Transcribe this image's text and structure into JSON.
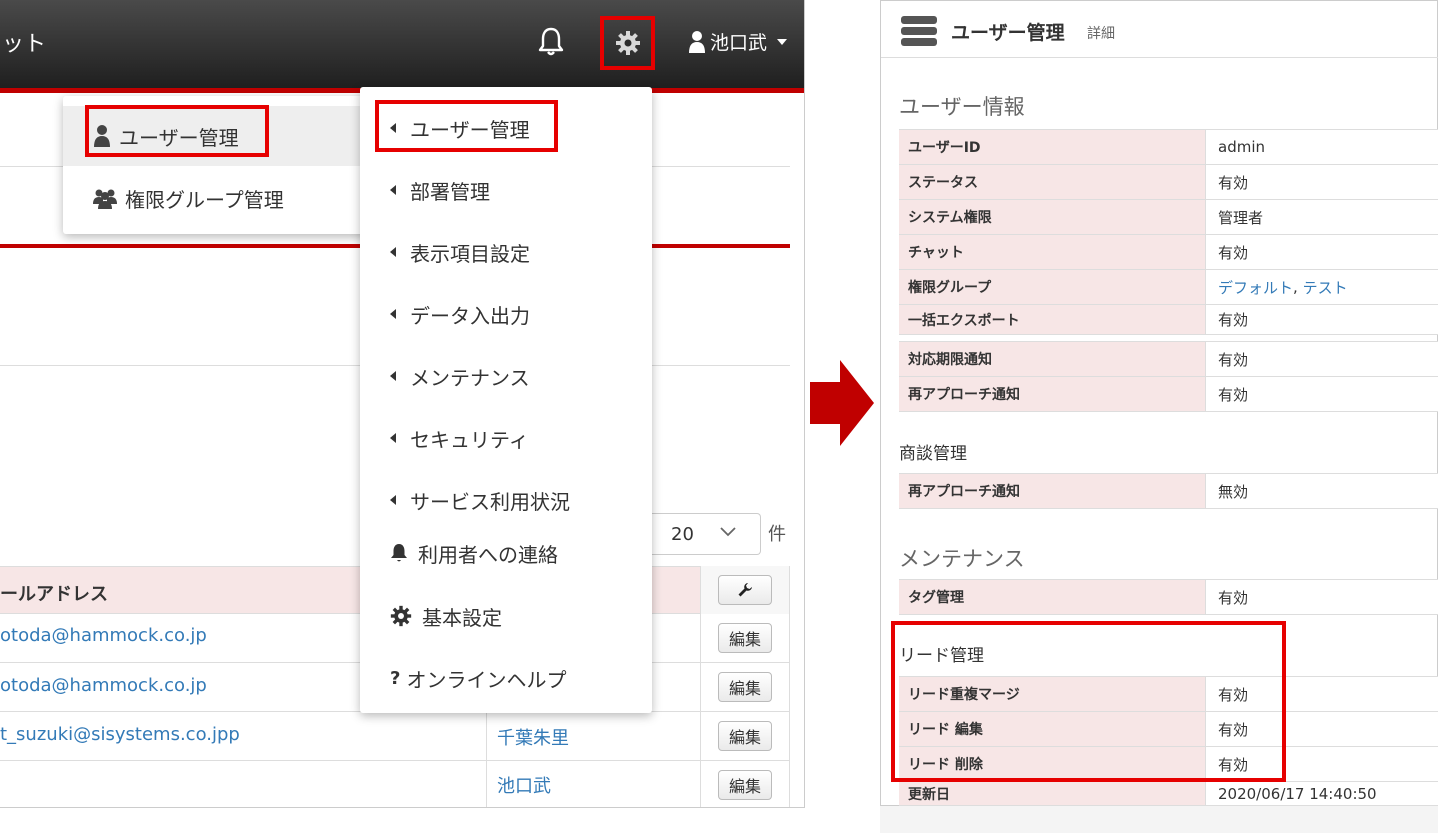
{
  "topbar": {
    "app_title_fragment": "ット",
    "user_name": "池口武"
  },
  "user_menu": {
    "items": [
      {
        "label": "ユーザー管理",
        "icon": "user-icon",
        "active": true
      },
      {
        "label": "権限グループ管理",
        "icon": "users-group-icon",
        "active": false
      }
    ]
  },
  "settings_menu": {
    "items": [
      {
        "label": "ユーザー管理",
        "icon": "caret-left-icon"
      },
      {
        "label": "部署管理",
        "icon": "caret-left-icon"
      },
      {
        "label": "表示項目設定",
        "icon": "caret-left-icon"
      },
      {
        "label": "データ入出力",
        "icon": "caret-left-icon"
      },
      {
        "label": "メンテナンス",
        "icon": "caret-left-icon"
      },
      {
        "label": "セキュリティ",
        "icon": "caret-left-icon"
      },
      {
        "label": "サービス利用状況",
        "icon": "caret-left-icon"
      },
      {
        "label": "利用者への連絡",
        "icon": "bell-icon"
      },
      {
        "label": "基本設定",
        "icon": "gear-icon"
      },
      {
        "label": "オンラインヘルプ",
        "icon": "question-icon"
      }
    ]
  },
  "list": {
    "page_size": "20",
    "page_size_unit": "件",
    "email_header": "ールアドレス",
    "edit_label": "編集",
    "rows": [
      {
        "email": "otoda@hammock.co.jp",
        "name": ""
      },
      {
        "email": "otoda@hammock.co.jp",
        "name": ""
      },
      {
        "email": "t_suzuki@sisystems.co.jpp",
        "name": "千葉朱里"
      },
      {
        "email": "",
        "name": "池口武"
      }
    ]
  },
  "detail": {
    "title": "ユーザー管理",
    "subtitle": "詳細",
    "user_info": {
      "heading": "ユーザー情報",
      "rows": [
        {
          "key": "ユーザーID",
          "value": "admin"
        },
        {
          "key": "ステータス",
          "value": "有効"
        },
        {
          "key": "システム権限",
          "value": "管理者"
        },
        {
          "key": "チャット",
          "value": "有効"
        },
        {
          "key": "権限グループ",
          "links": [
            "デフォルト",
            "テスト"
          ],
          "separator": ", "
        },
        {
          "key": "一括エクスポート",
          "value": "有効"
        }
      ]
    },
    "notify_rows": [
      {
        "key": "対応期限通知",
        "value": "有効"
      },
      {
        "key": "再アプローチ通知",
        "value": "有効"
      }
    ],
    "deal": {
      "heading": "商談管理",
      "rows": [
        {
          "key": "再アプローチ通知",
          "value": "無効"
        }
      ]
    },
    "maintenance": {
      "heading": "メンテナンス",
      "rows": [
        {
          "key": "タグ管理",
          "value": "有効"
        }
      ]
    },
    "lead": {
      "heading": "リード管理",
      "rows": [
        {
          "key": "リード重複マージ",
          "value": "有効"
        },
        {
          "key": "リード 編集",
          "value": "有効"
        },
        {
          "key": "リード 削除",
          "value": "有効"
        }
      ]
    },
    "updated": {
      "key": "更新日",
      "value": "2020/06/17 14:40:50"
    }
  },
  "colors": {
    "accent_red": "#e60000",
    "header_red": "#c00000",
    "link_blue": "#337ab7",
    "key_bg": "#f7e6e6"
  }
}
